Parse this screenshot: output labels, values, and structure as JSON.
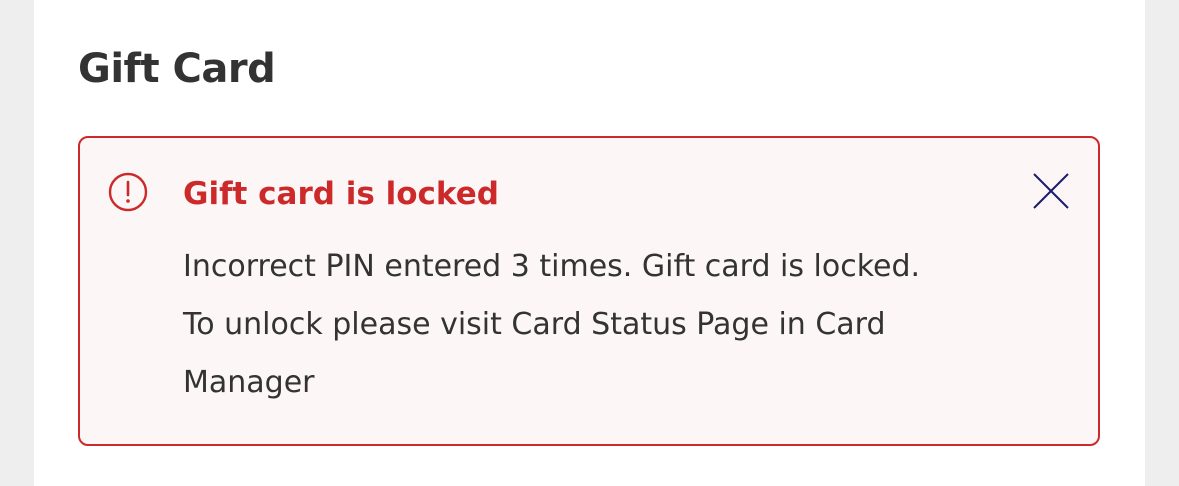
{
  "card": {
    "title": "Gift Card"
  },
  "alert": {
    "icon": "alert-circle-icon",
    "heading": "Gift card is locked",
    "lines": [
      "Incorrect PIN entered 3 times. Gift card is locked.",
      "To unlock please visit Card Status Page in Card",
      "Manager"
    ],
    "close_icon": "close-icon"
  },
  "colors": {
    "page_background": "#eeeeee",
    "card_background": "#ffffff",
    "alert_accent": "#cc2a2a",
    "alert_background": "#fcf6f6",
    "text": "#333333",
    "close_icon": "#1c1c6e"
  }
}
